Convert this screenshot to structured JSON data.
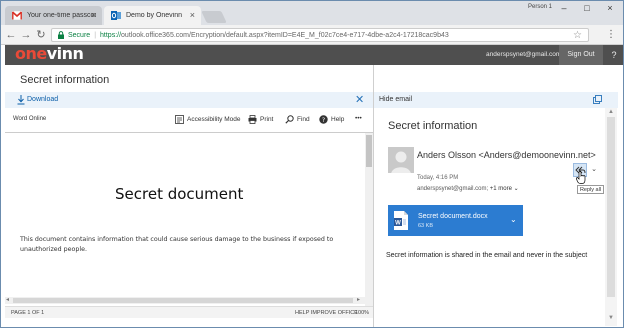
{
  "browser": {
    "tabs": [
      {
        "title": "Your one-time passcode",
        "icon": "gmail-icon"
      },
      {
        "title": "Demo by Onevinn",
        "icon": "outlook-icon"
      }
    ],
    "user_label": "Person 1",
    "secure_label": "Secure",
    "url_protocol": "https://",
    "url_rest": "outlook.office365.com/Encryption/default.aspx?itemID=E4E_M_f02c7ce4-e717-4dbe-a2c4-17218cac9b43"
  },
  "header": {
    "logo_part1": "one",
    "logo_part2": "vinn",
    "email": "anderspsynet@gmail.com",
    "sign_out": "Sign Out",
    "help": "?"
  },
  "left": {
    "title": "Secret information",
    "download_label": "Download",
    "close_glyph": "✕",
    "word_online": "Word Online",
    "tools": {
      "accessibility": "Accessibility Mode",
      "print": "Print",
      "find": "Find",
      "help": "Help",
      "more": "•••"
    },
    "document": {
      "title": "Secret document",
      "body": "This document contains information that could cause serious damage to the business if exposed to unauthorized people."
    },
    "status": {
      "page": "PAGE 1 OF 1",
      "help_improve": "HELP IMPROVE OFFICE",
      "zoom": "100%"
    }
  },
  "right": {
    "hide_label": "Hide email",
    "title": "Secret information",
    "sender": "Anders Olsson <Anders@demoonevinn.net>",
    "date": "Today, 4:16 PM",
    "recipients": "anderspsynet@gmail.com;",
    "more_recipients": "+1 more",
    "tooltip": "Reply all",
    "attachment": {
      "name": "Secret document.docx",
      "size": "63 KB"
    },
    "body": "Secret information is shared in the email and never in the subject"
  },
  "colors": {
    "brand_red": "#e84a38",
    "header_dark": "#4f4f4f",
    "accent_blue": "#2c7cd1",
    "secure_green": "#0b8043"
  }
}
